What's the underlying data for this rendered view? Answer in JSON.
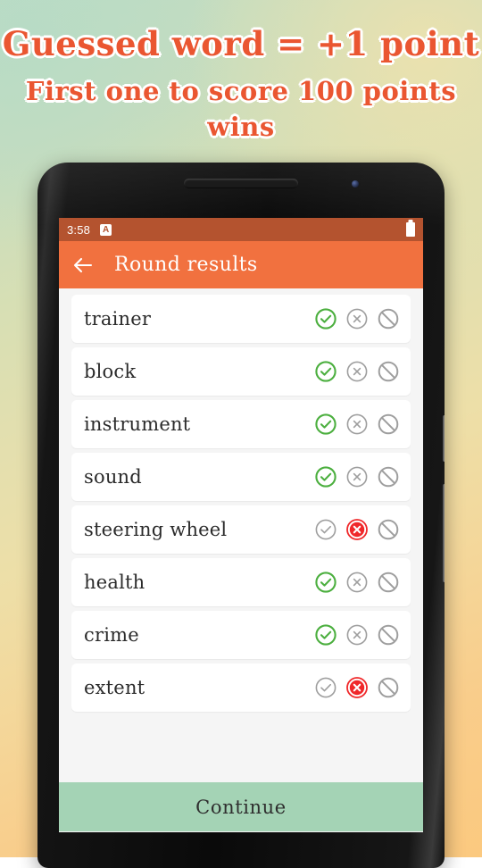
{
  "promo": {
    "line1": "Guessed word = +1 point",
    "line2": "First one to score 100 points wins",
    "text_color": "#ea5631",
    "outline_color": "#ffffff"
  },
  "background": {
    "top_left_color": "#bedcc4",
    "top_right_color": "#efe0ad",
    "bottom_color": "#fbc97f"
  },
  "device": {
    "frame_color": "#0d0d0d",
    "speaker_name": "earpiece-speaker",
    "camera_name": "front-camera"
  },
  "status_bar": {
    "time": "3:58",
    "alarm_label": "A",
    "battery_icon": "battery-full-icon",
    "background_color": "#b4532f"
  },
  "app_bar": {
    "back_icon": "arrow-left-icon",
    "title": "Round results",
    "background_color": "#f1713f",
    "text_color": "#ffffff"
  },
  "marks": {
    "correct_icon": "check-circle-icon",
    "wrong_icon": "x-circle-icon",
    "skip_icon": "block-circle-icon",
    "selected_correct_color": "#4caf3f",
    "selected_wrong_color": "#f0282a",
    "unselected_color": "#9e9e9e"
  },
  "list": {
    "background_color": "#f5f5f5",
    "card_color": "#ffffff",
    "rows": [
      {
        "word": "trainer",
        "state": "correct"
      },
      {
        "word": "block",
        "state": "correct"
      },
      {
        "word": "instrument",
        "state": "correct"
      },
      {
        "word": "sound",
        "state": "correct"
      },
      {
        "word": "steering wheel",
        "state": "wrong"
      },
      {
        "word": "health",
        "state": "correct"
      },
      {
        "word": "crime",
        "state": "correct"
      },
      {
        "word": "extent",
        "state": "wrong"
      }
    ]
  },
  "continue_button": {
    "label": "Continue",
    "background_color": "#a4d3b5",
    "text_color": "#2f2f2f"
  }
}
